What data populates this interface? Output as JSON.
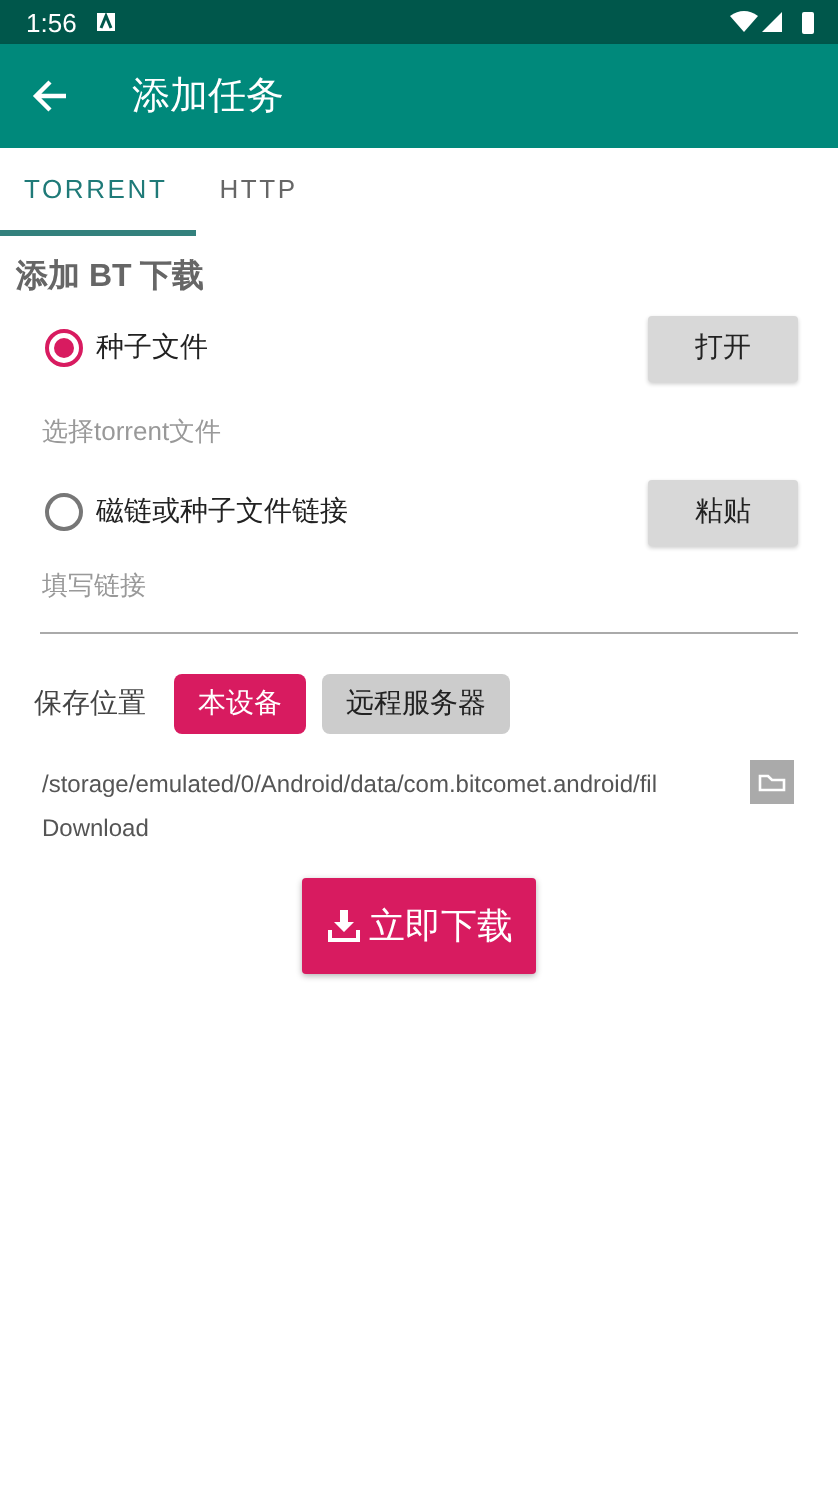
{
  "status_bar": {
    "time": "1:56"
  },
  "app_bar": {
    "title": "添加任务"
  },
  "tabs": [
    {
      "label": "TORRENT",
      "selected": true
    },
    {
      "label": "HTTP",
      "selected": false
    }
  ],
  "section_title": "添加 BT 下载",
  "sources": [
    {
      "label": "种子文件",
      "selected": true,
      "button": "打开",
      "placeholder": "选择torrent文件",
      "kind": "hint"
    },
    {
      "label": "磁链或种子文件链接",
      "selected": false,
      "button": "粘贴",
      "placeholder": "填写链接",
      "kind": "field"
    }
  ],
  "save_location": {
    "label": "保存位置",
    "options": [
      {
        "label": "本设备",
        "selected": true
      },
      {
        "label": "远程服务器",
        "selected": false
      }
    ]
  },
  "path": {
    "line_1": "/storage/emulated/0/Android/data/com.bitcomet.android/fil",
    "line_2": "Download"
  },
  "download_button": "立即下载"
}
